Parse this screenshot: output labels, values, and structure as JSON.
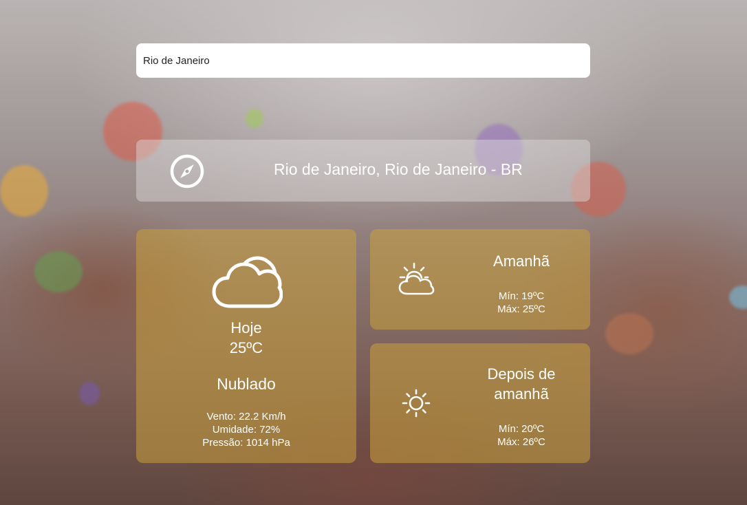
{
  "search": {
    "value": "Rio de Janeiro",
    "icon": "compass-icon"
  },
  "location": {
    "label": "Rio de Janeiro, Rio de Janeiro - BR"
  },
  "today": {
    "label": "Hoje",
    "temperature": "25ºC",
    "description": "Nublado",
    "wind": "Vento: 22.2 Km/h",
    "humidity": "Umidade: 72%",
    "pressure": "Pressão: 1014 hPa",
    "icon": "cloud-icon"
  },
  "tomorrow": {
    "label": "Amanhã",
    "min": "Mín: 19ºC",
    "max": "Máx: 25ºC",
    "icon": "partly-cloudy-icon"
  },
  "day_after": {
    "label_line1": "Depois de",
    "label_line2": "amanhã",
    "min": "Mín: 20ºC",
    "max": "Máx: 26ºC",
    "icon": "sun-icon"
  },
  "colors": {
    "card_today": "#c8a03c",
    "card_forecast": "#c8a03c",
    "text": "#ffffff"
  }
}
